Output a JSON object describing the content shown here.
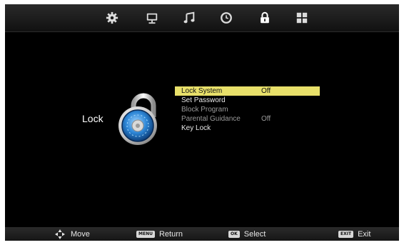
{
  "top_icons": [
    {
      "name": "settings-gear-icon"
    },
    {
      "name": "picture-monitor-icon"
    },
    {
      "name": "sound-music-note-icon"
    },
    {
      "name": "time-clock-icon"
    },
    {
      "name": "lock-icon",
      "active": true
    },
    {
      "name": "apps-grid-icon"
    }
  ],
  "section": {
    "title": "Lock",
    "icon": "padlock-icon"
  },
  "menu": [
    {
      "label": "Lock System",
      "value": "Off",
      "selected": true,
      "enabled": true
    },
    {
      "label": "Set Password",
      "value": "",
      "selected": false,
      "enabled": true
    },
    {
      "label": "Block Program",
      "value": "",
      "selected": false,
      "enabled": false
    },
    {
      "label": "Parental Guidance",
      "value": "Off",
      "selected": false,
      "enabled": false
    },
    {
      "label": "Key Lock",
      "value": "",
      "selected": false,
      "enabled": true
    }
  ],
  "hints": {
    "move": {
      "label": "Move"
    },
    "return": {
      "key": "MENU",
      "label": "Return"
    },
    "select": {
      "key": "OK",
      "label": "Select"
    },
    "exit": {
      "key": "EXIT",
      "label": "Exit"
    }
  },
  "colors": {
    "highlight": "#e8e06a",
    "background": "#000000",
    "text": "#e8e8e8",
    "text_dim": "#9a9a9a"
  }
}
